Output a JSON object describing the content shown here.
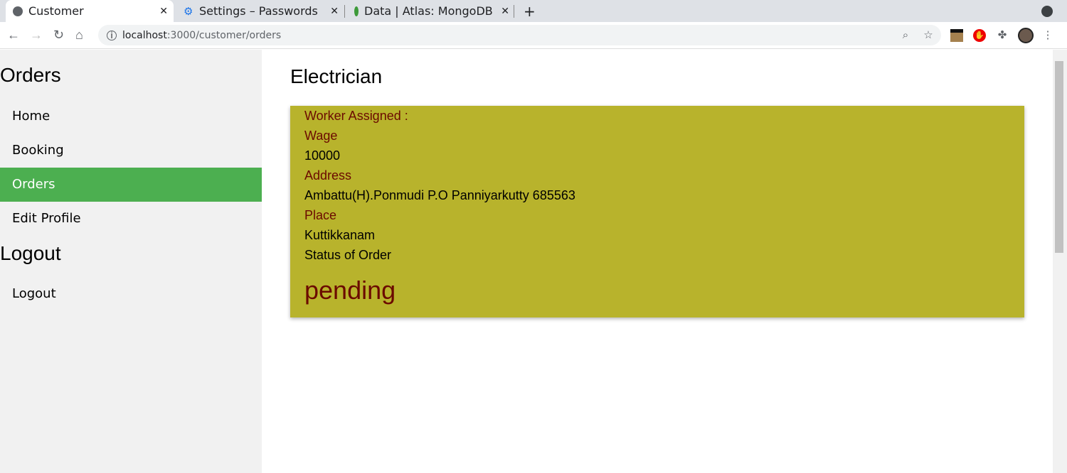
{
  "browser": {
    "tabs": [
      {
        "title": "Customer",
        "icon": "globe-icon"
      },
      {
        "title": "Settings – Passwords",
        "icon": "gear-icon"
      },
      {
        "title": "Data | Atlas: MongoDB",
        "icon": "mongodb-leaf-icon"
      }
    ],
    "url_host": "localhost",
    "url_path": ":3000/customer/orders"
  },
  "sidebar": {
    "heading": "Orders",
    "items": [
      {
        "label": "Home"
      },
      {
        "label": "Booking"
      },
      {
        "label": "Orders"
      },
      {
        "label": "Edit Profile"
      }
    ],
    "heading2": "Logout",
    "logout": "Logout"
  },
  "main": {
    "title": "Electrician",
    "card": {
      "worker_label": "Worker Assigned :",
      "wage_label": "Wage",
      "wage": "10000",
      "address_label": "Address",
      "address": "Ambattu(H).Ponmudi P.O Panniyarkutty 685563",
      "place_label": "Place",
      "place": "Kuttikkanam",
      "status_label": "Status of Order",
      "status": "pending"
    }
  },
  "colors": {
    "active": "#4caf50",
    "card": "#b8b32c",
    "label": "#6b0a00"
  }
}
